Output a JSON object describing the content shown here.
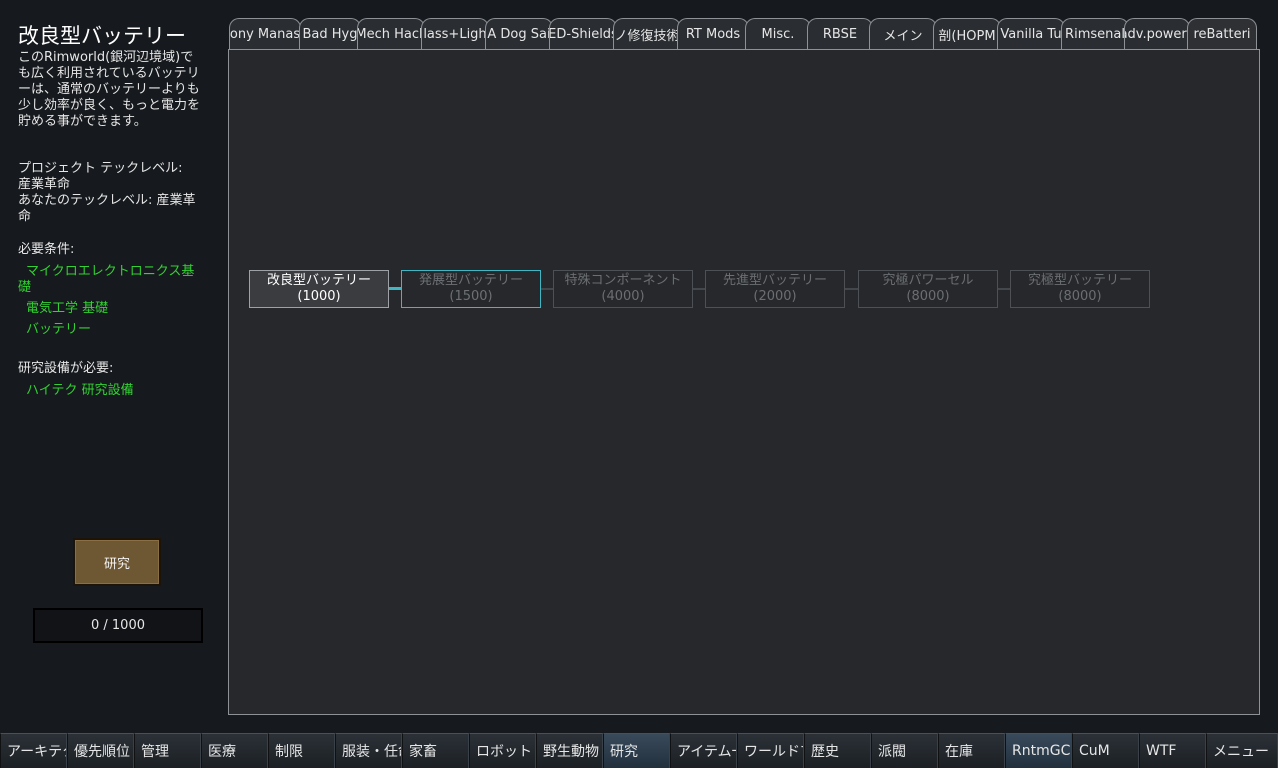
{
  "project": {
    "title": "改良型バッテリー",
    "description": "このRimworld(銀河辺境域)でも広く利用されているバッテリーは、通常のバッテリーよりも少し効率が良く、もっと電力を貯める事ができます。",
    "tech_level_label": "プロジェクト テックレベル:",
    "tech_level_value": "産業革命",
    "your_level_label": "あなたのテックレベル:",
    "your_level_value": "産業革命",
    "prereq_label": "必要条件:",
    "prerequisites": [
      "マイクロエレクトロニクス基礎",
      "電気工学 基礎",
      "バッテリー"
    ],
    "bench_label": "研究設備が必要:",
    "bench_value": "ハイテク 研究設備",
    "research_button": "研究",
    "progress_text": "0 / 1000",
    "progress_fraction": 0
  },
  "tabs": [
    {
      "label": "ony Manas",
      "active": false
    },
    {
      "label": "Bad Hyg",
      "active": false
    },
    {
      "label": "Mech Hack",
      "active": false
    },
    {
      "label": "lass+Ligh",
      "active": false
    },
    {
      "label": "A Dog Sai",
      "active": false
    },
    {
      "label": "ED-Shields",
      "active": false
    },
    {
      "label": "ノ修復技術",
      "active": false
    },
    {
      "label": "RT Mods",
      "active": false
    },
    {
      "label": "Misc.",
      "active": false
    },
    {
      "label": "RBSE",
      "active": false
    },
    {
      "label": "メイン",
      "active": false
    },
    {
      "label": "剖(HOPM",
      "active": false
    },
    {
      "label": "Vanilla Tu",
      "active": false
    },
    {
      "label": "Rimsenal",
      "active": false
    },
    {
      "label": "adv.powero",
      "active": false
    },
    {
      "label": "reBatteri",
      "active": true
    }
  ],
  "nodes": [
    {
      "name": "改良型バッテリー",
      "cost": "(1000)",
      "state": "selected"
    },
    {
      "name": "発展型バッテリー",
      "cost": "(1500)",
      "state": "available"
    },
    {
      "name": "特殊コンポーネント",
      "cost": "(4000)",
      "state": "locked"
    },
    {
      "name": "先進型バッテリー",
      "cost": "(2000)",
      "state": "locked"
    },
    {
      "name": "究極パワーセル",
      "cost": "(8000)",
      "state": "locked"
    },
    {
      "name": "究極型バッテリー",
      "cost": "(8000)",
      "state": "locked"
    }
  ],
  "bottom_bar": [
    {
      "label": "アーキテクト",
      "active": false
    },
    {
      "label": "優先順位",
      "active": false
    },
    {
      "label": "管理",
      "active": false
    },
    {
      "label": "医療",
      "active": false
    },
    {
      "label": "制限",
      "active": false
    },
    {
      "label": "服装・任命",
      "active": false
    },
    {
      "label": "家畜",
      "active": false
    },
    {
      "label": "ロボット",
      "active": false
    },
    {
      "label": "野生動物",
      "active": false
    },
    {
      "label": "研究",
      "active": true
    },
    {
      "label": "アイテム一覧",
      "active": false
    },
    {
      "label": "ワールドマップ",
      "active": false
    },
    {
      "label": "歴史",
      "active": false
    },
    {
      "label": "派閥",
      "active": false
    },
    {
      "label": "在庫",
      "active": false
    },
    {
      "label": "RntmGC",
      "active": true
    },
    {
      "label": "CuM",
      "active": false
    },
    {
      "label": "WTF",
      "active": false
    },
    {
      "label": "メニュー",
      "active": false
    }
  ],
  "colors": {
    "prerequisite": "#33d133",
    "available_border": "#3fb6c4",
    "button_brown": "#6e5733"
  }
}
